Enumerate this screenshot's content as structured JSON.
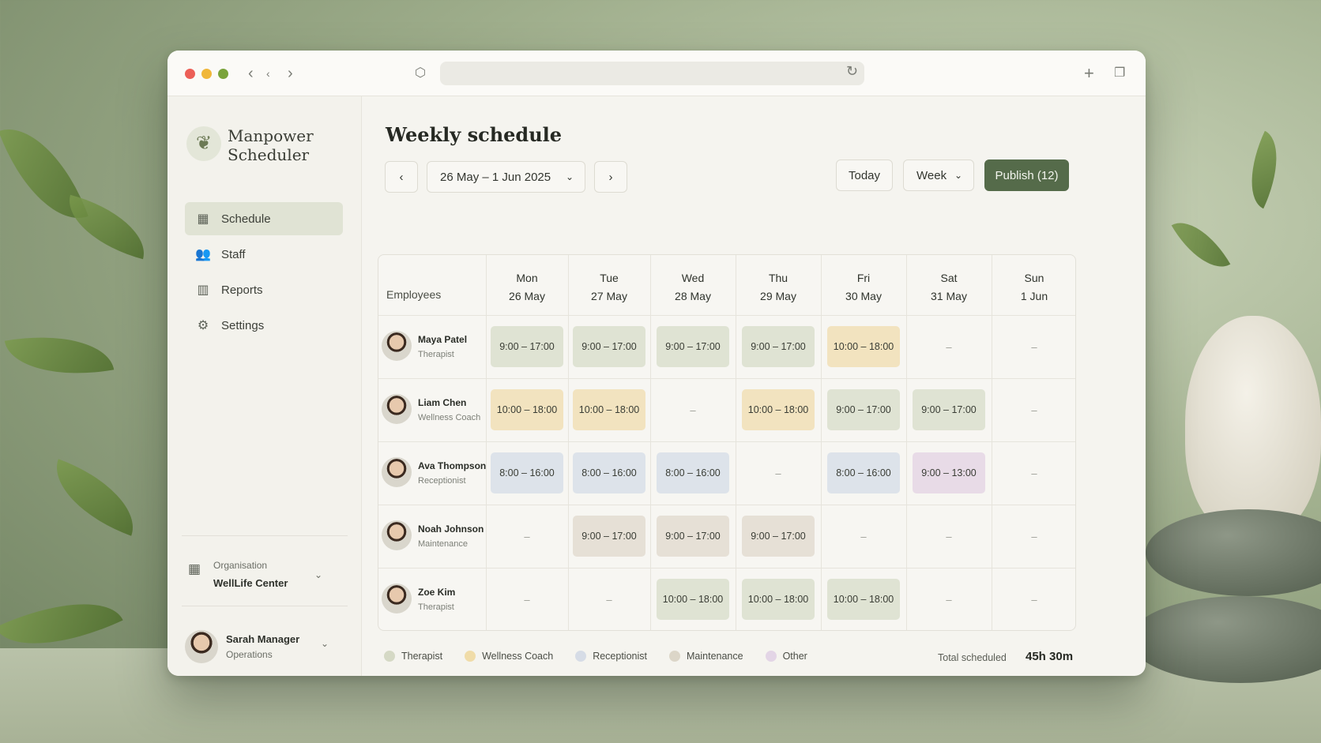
{
  "app": {
    "brand_line1": "Manpower",
    "brand_line2": "Scheduler",
    "page_title": "Weekly schedule"
  },
  "nav": [
    {
      "label": "Schedule",
      "icon": "calendar-icon",
      "active": true
    },
    {
      "label": "Staff",
      "icon": "users-icon",
      "active": false
    },
    {
      "label": "Reports",
      "icon": "chart-icon",
      "active": false
    },
    {
      "label": "Settings",
      "icon": "gear-icon",
      "active": false
    }
  ],
  "organisation": {
    "label": "Organisation",
    "value": "WellLife Center"
  },
  "current_user": {
    "name": "Sarah Manager",
    "role": "Operations"
  },
  "toolbar": {
    "date_range": "26 May – 1 Jun 2025",
    "today_label": "Today",
    "view_label": "Week",
    "publish_label": "Publish (12)"
  },
  "grid": {
    "employees_header": "Employees",
    "days": [
      {
        "name": "Mon",
        "date": "26 May"
      },
      {
        "name": "Tue",
        "date": "27 May"
      },
      {
        "name": "Wed",
        "date": "28 May"
      },
      {
        "name": "Thu",
        "date": "29 May"
      },
      {
        "name": "Fri",
        "date": "30 May"
      },
      {
        "name": "Sat",
        "date": "31 May"
      },
      {
        "name": "Sun",
        "date": "1 Jun"
      }
    ],
    "rows": [
      {
        "name": "Maya Patel",
        "role": "Therapist",
        "shifts": [
          [
            "9:00 – 17:00",
            "therapist"
          ],
          [
            "9:00 – 17:00",
            "therapist"
          ],
          [
            "9:00 – 17:00",
            "therapist"
          ],
          [
            "9:00 – 17:00",
            "therapist"
          ],
          [
            "10:00 – 18:00",
            "coach"
          ],
          [
            "–",
            "none"
          ],
          [
            "–",
            "none"
          ]
        ]
      },
      {
        "name": "Liam Chen",
        "role": "Wellness Coach",
        "shifts": [
          [
            "10:00 – 18:00",
            "coach"
          ],
          [
            "10:00 – 18:00",
            "coach"
          ],
          [
            "–",
            "none"
          ],
          [
            "10:00 – 18:00",
            "coach"
          ],
          [
            "9:00 – 17:00",
            "therapist"
          ],
          [
            "9:00 – 17:00",
            "therapist"
          ],
          [
            "–",
            "none"
          ]
        ]
      },
      {
        "name": "Ava Thompson",
        "role": "Receptionist",
        "shifts": [
          [
            "8:00 – 16:00",
            "reception"
          ],
          [
            "8:00 – 16:00",
            "reception"
          ],
          [
            "8:00 – 16:00",
            "reception"
          ],
          [
            "–",
            "none"
          ],
          [
            "8:00 – 16:00",
            "reception"
          ],
          [
            "9:00 – 13:00",
            "other"
          ],
          [
            "–",
            "none"
          ]
        ]
      },
      {
        "name": "Noah Johnson",
        "role": "Maintenance",
        "shifts": [
          [
            "–",
            "none"
          ],
          [
            "9:00 – 17:00",
            "maint"
          ],
          [
            "9:00 – 17:00",
            "maint"
          ],
          [
            "9:00 – 17:00",
            "maint"
          ],
          [
            "–",
            "none"
          ],
          [
            "–",
            "none"
          ],
          [
            "–",
            "none"
          ]
        ]
      },
      {
        "name": "Zoe Kim",
        "role": "Therapist",
        "shifts": [
          [
            "–",
            "none"
          ],
          [
            "–",
            "none"
          ],
          [
            "10:00 – 18:00",
            "therapist"
          ],
          [
            "10:00 – 18:00",
            "therapist"
          ],
          [
            "10:00 – 18:00",
            "therapist"
          ],
          [
            "–",
            "none"
          ],
          [
            "–",
            "none"
          ]
        ]
      }
    ]
  },
  "legend": [
    {
      "label": "Therapist",
      "color": "#d5d9c5"
    },
    {
      "label": "Wellness Coach",
      "color": "#f0dca8"
    },
    {
      "label": "Receptionist",
      "color": "#d6dce6"
    },
    {
      "label": "Maintenance",
      "color": "#dcd6c8"
    },
    {
      "label": "Other",
      "color": "#e3d5e6"
    }
  ],
  "summary": {
    "total_label": "Total scheduled",
    "total_value": "45h 30m"
  },
  "colors": {
    "accent": "#556b4a"
  }
}
